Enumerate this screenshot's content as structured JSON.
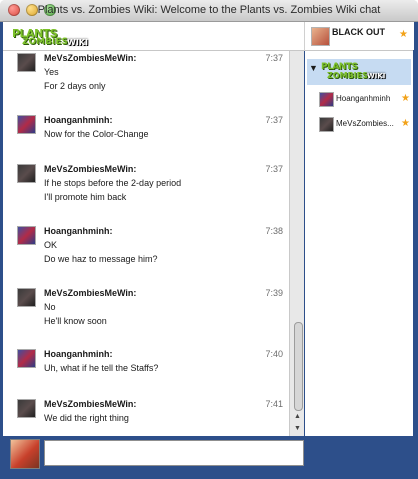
{
  "window": {
    "title": "Plants vs. Zombies Wiki: Welcome to the Plants vs. Zombies Wiki chat"
  },
  "header": {
    "logo_line1": "PLANTS",
    "logo_line2": "ZOMBIES",
    "logo_wiki": "WIKI",
    "current_user": "BLACK OUT",
    "star_icon": "★"
  },
  "messages": [
    {
      "user": "MeVsZombiesMeWin:",
      "time": "7:37",
      "lines": [
        "Yes",
        "For 2 days only"
      ],
      "avatar": "mevszombies"
    },
    {
      "user": "Hoanganhminh:",
      "time": "7:37",
      "lines": [
        "Now for the Color-Change"
      ],
      "avatar": "hoanganhminh"
    },
    {
      "user": "MeVsZombiesMeWin:",
      "time": "7:37",
      "lines": [
        "If he stops before the 2-day period",
        "I'll promote him back"
      ],
      "avatar": "mevszombies"
    },
    {
      "user": "Hoanganhminh:",
      "time": "7:38",
      "lines": [
        "OK",
        "Do we haz to message him?"
      ],
      "avatar": "hoanganhminh"
    },
    {
      "user": "MeVsZombiesMeWin:",
      "time": "7:39",
      "lines": [
        "No",
        "He'll know soon"
      ],
      "avatar": "mevszombies"
    },
    {
      "user": "Hoanganhminh:",
      "time": "7:40",
      "lines": [
        "Uh, what if he tell the Staffs?"
      ],
      "avatar": "hoanganhminh"
    },
    {
      "user": "MeVsZombiesMeWin:",
      "time": "7:41",
      "lines": [
        "We did the right thing"
      ],
      "avatar": "mevszombies"
    }
  ],
  "userlist": {
    "users": [
      {
        "name": "Hoanganhminh",
        "star": "★"
      },
      {
        "name": "MeVsZombies...",
        "star": "★"
      }
    ]
  },
  "input": {
    "value": "",
    "placeholder": ""
  },
  "colors": {
    "frame": "#2d4f8a",
    "userlist_header": "#c6dbf2",
    "star": "#f2a219",
    "logo_green": "#7cc12a"
  }
}
